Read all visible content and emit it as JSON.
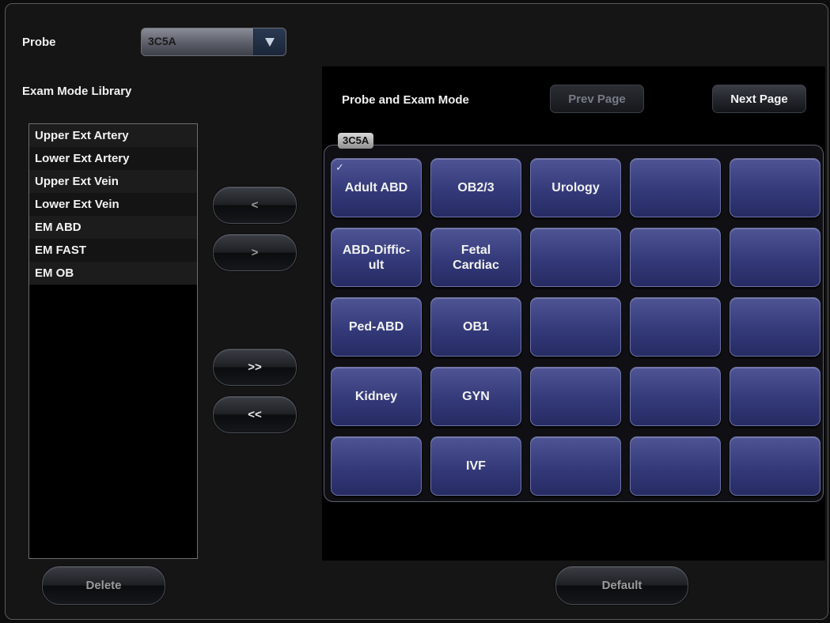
{
  "probe": {
    "label": "Probe",
    "value": "3C5A"
  },
  "library": {
    "label": "Exam Mode Library",
    "items": [
      "Upper Ext Artery",
      "Lower Ext Artery",
      "Upper Ext Vein",
      "Lower Ext Vein",
      "EM ABD",
      "EM FAST",
      "EM OB"
    ]
  },
  "transfer": {
    "add": "<",
    "remove": ">",
    "add_all": ">>",
    "remove_all": "<<"
  },
  "panel": {
    "title": "Probe and Exam Mode",
    "prev_label": "Prev Page",
    "next_label": "Next Page",
    "group_label": "3C5A",
    "tiles": [
      "Adult ABD",
      "OB2/3",
      "Urology",
      "",
      "",
      "ABD-Diffic-\nult",
      "Fetal\nCardiac",
      "",
      "",
      "",
      "Ped-ABD",
      "OB1",
      "",
      "",
      "",
      "Kidney",
      "GYN",
      "",
      "",
      "",
      "",
      "IVF",
      "",
      "",
      ""
    ],
    "selected_index": 0,
    "check_mark": "✓"
  },
  "footer": {
    "delete_label": "Delete",
    "default_label": "Default"
  },
  "colors": {
    "tile": "#343a79",
    "background": "#151515"
  }
}
